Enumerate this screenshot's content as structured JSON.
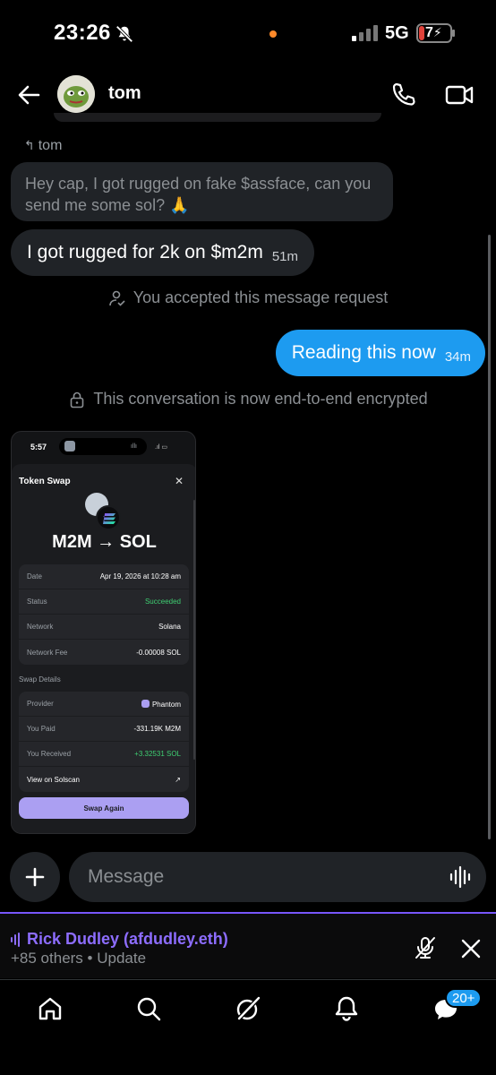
{
  "status_bar": {
    "time": "23:26",
    "network": "5G",
    "battery": "7",
    "accent_color": "#ff8a2a"
  },
  "header": {
    "contact_name": "tom",
    "icons": [
      "back-arrow-icon",
      "phone-icon",
      "video-icon"
    ]
  },
  "conversation": {
    "reply_to": "tom",
    "quoted_message": "Hey cap, I got rugged on fake $assface, can you send me some sol? 🙏",
    "incoming": {
      "text": "I got rugged for 2k on $m2m",
      "time": "51m"
    },
    "accepted_notice": "You accepted this message request",
    "outgoing": {
      "text": "Reading this now",
      "time": "34m"
    },
    "encrypted_notice": "This conversation is now end-to-end encrypted"
  },
  "attachment": {
    "time": "5:57",
    "title": "Token Swap",
    "pair": "M2M → SOL",
    "details": [
      {
        "key": "Date",
        "value": "Apr 19, 2026 at 10:28 am"
      },
      {
        "key": "Status",
        "value": "Succeeded"
      },
      {
        "key": "Network",
        "value": "Solana"
      },
      {
        "key": "Network Fee",
        "value": "-0.00008 SOL"
      }
    ],
    "swap_section": "Swap Details",
    "swap": [
      {
        "key": "Provider",
        "value": "Phantom"
      },
      {
        "key": "You Paid",
        "value": "-331.19K M2M"
      },
      {
        "key": "You Received",
        "value": "+3.32531 SOL"
      },
      {
        "key": "View on Solscan",
        "value": ""
      }
    ],
    "button": "Swap Again"
  },
  "composer": {
    "placeholder": "Message"
  },
  "space": {
    "host": "Rick Dudley (afdudley.eth)",
    "subtitle": "+85 others • Update",
    "accent": "#8d6dff"
  },
  "tabs": {
    "items": [
      "home",
      "search",
      "grok",
      "notifications",
      "messages"
    ],
    "messages_badge": "20+"
  }
}
